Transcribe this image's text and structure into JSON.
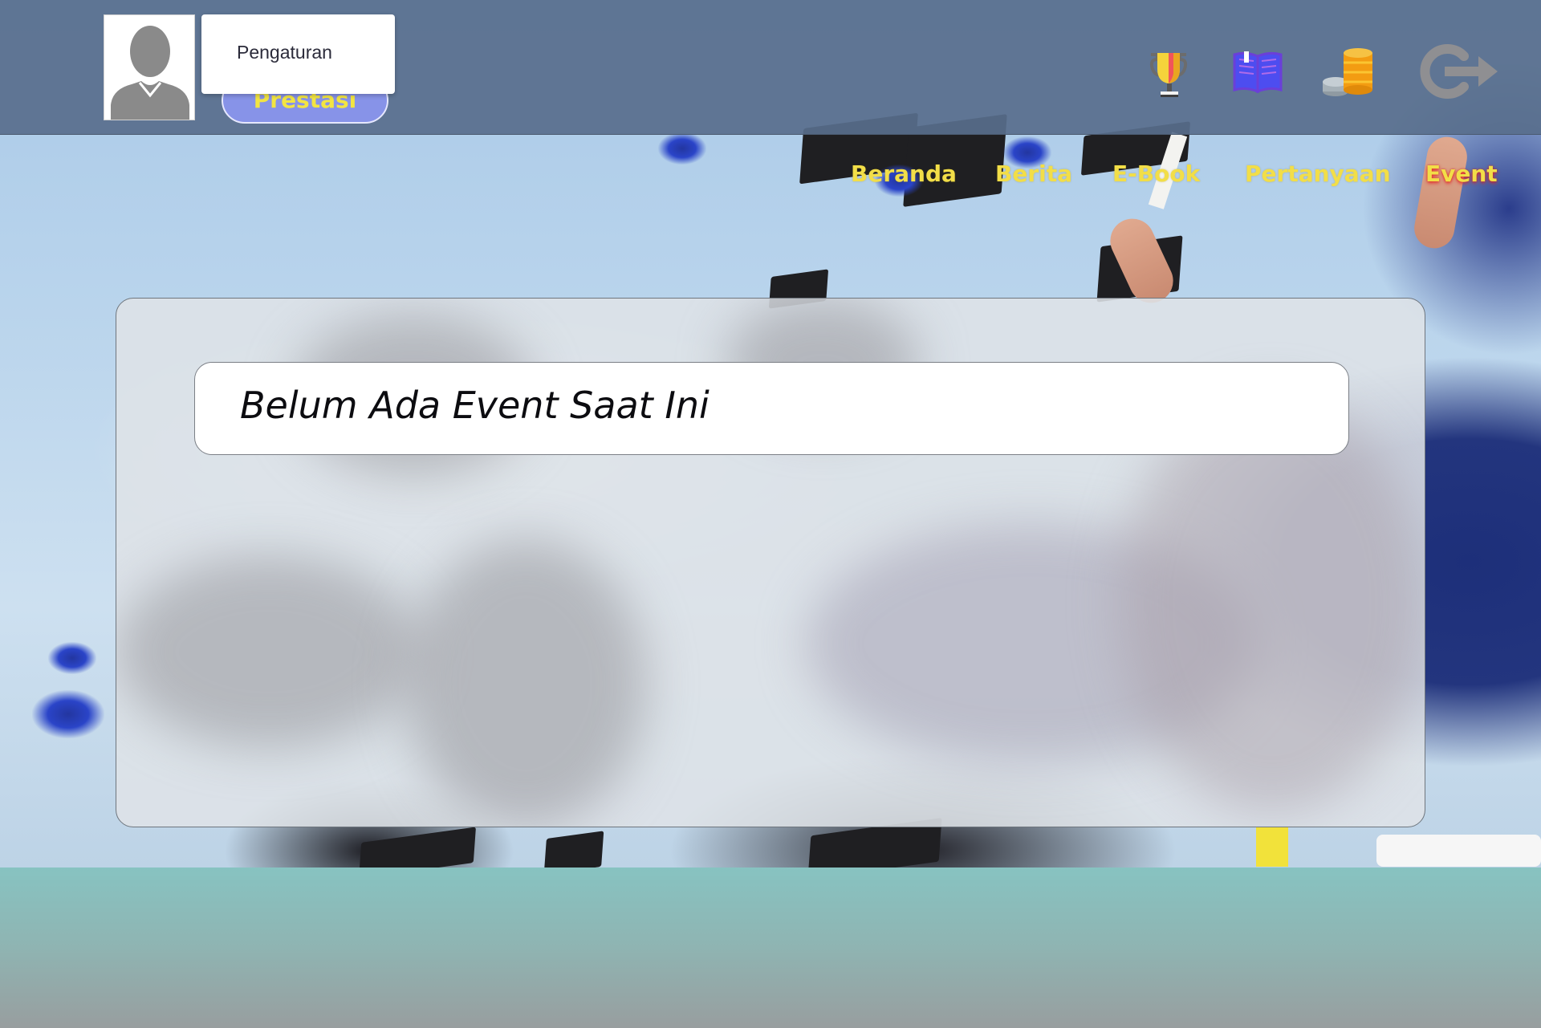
{
  "header": {
    "avatar_alt": "profile",
    "prestasi_label": "Prestasi",
    "dropdown": {
      "items": [
        {
          "label": "Pengaturan"
        }
      ]
    },
    "icons": [
      {
        "name": "trophy-icon"
      },
      {
        "name": "book-icon"
      },
      {
        "name": "coins-icon"
      },
      {
        "name": "logout-icon"
      }
    ]
  },
  "nav": {
    "items": [
      {
        "label": "Beranda",
        "active": false
      },
      {
        "label": "Berita",
        "active": false
      },
      {
        "label": "E-Book",
        "active": false
      },
      {
        "label": "Pertanyaan",
        "active": false
      },
      {
        "label": "Event",
        "active": true
      }
    ]
  },
  "main": {
    "empty_message": "Belum Ada Event Saat Ini"
  },
  "colors": {
    "nav_text": "#f2de48",
    "header_bg": "#586e8c",
    "prestasi_bg": "#8793e8",
    "footer_bg": "#87c3c1"
  }
}
